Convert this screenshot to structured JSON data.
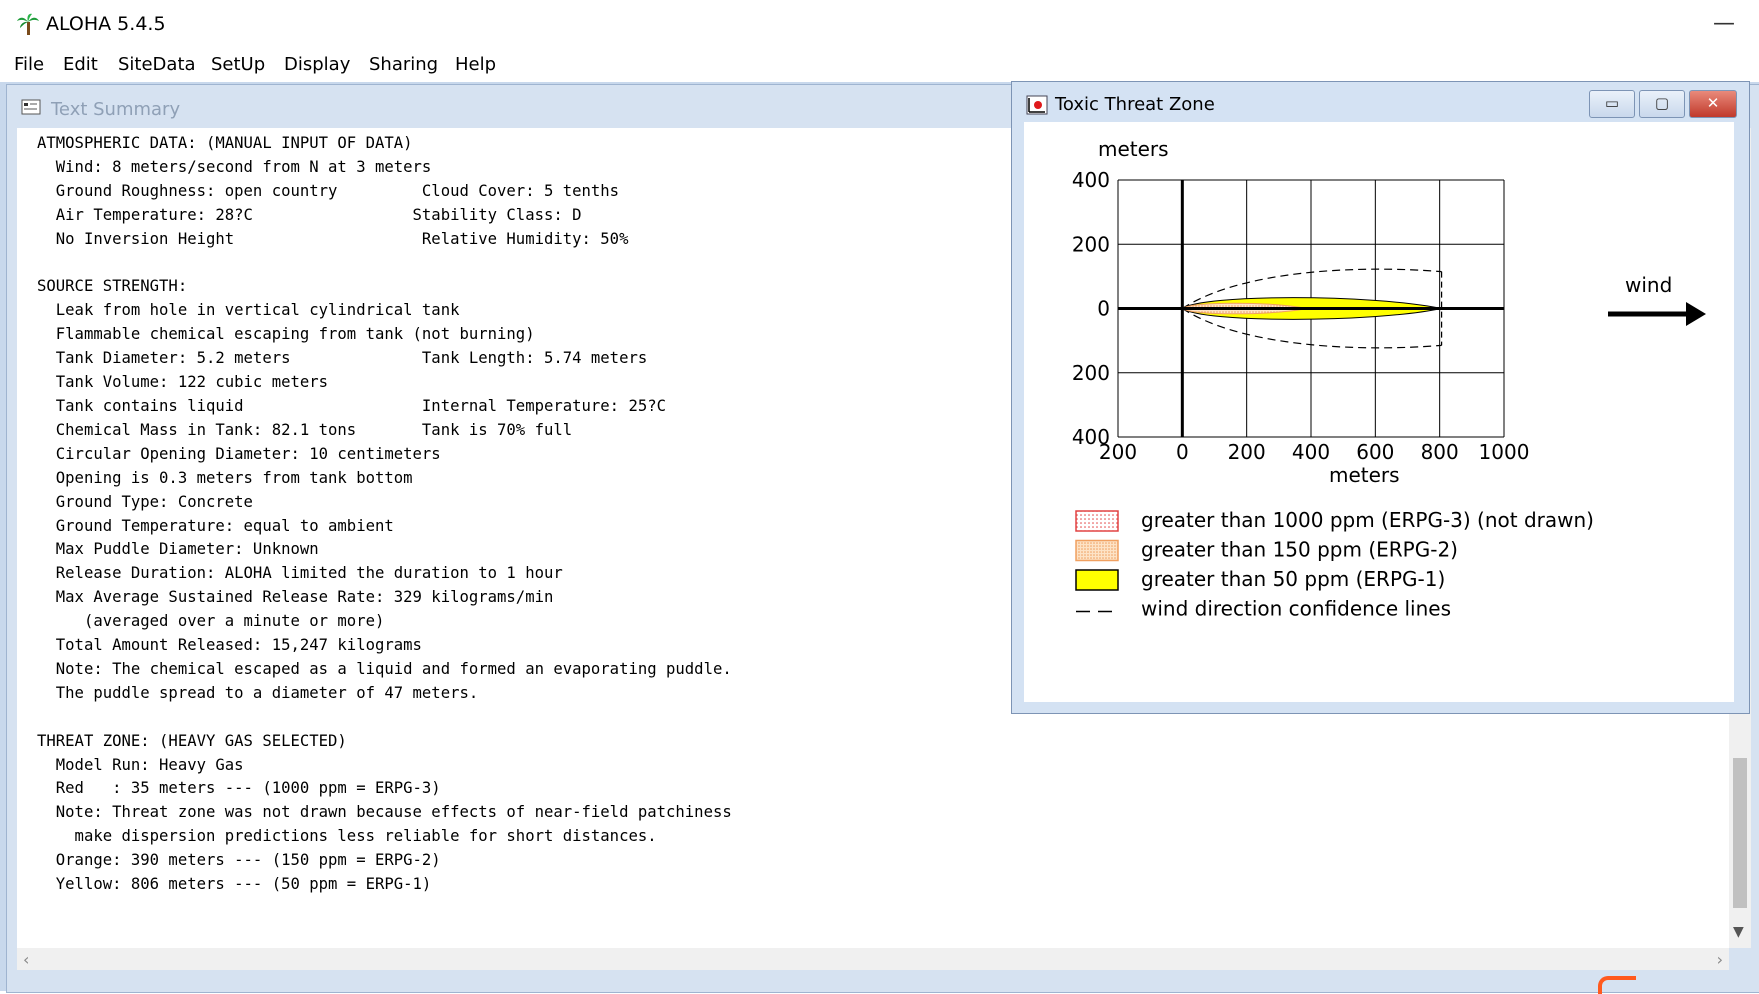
{
  "app": {
    "title": "ALOHA 5.4.5",
    "icon": "palm-tree-icon"
  },
  "titlebar": {
    "minimize_glyph": "—"
  },
  "menu": [
    "File",
    "Edit",
    "SiteData",
    "SetUp",
    "Display",
    "Sharing",
    "Help"
  ],
  "text_summary": {
    "title": "Text Summary",
    "lines": [
      "ATMOSPHERIC DATA: (MANUAL INPUT OF DATA)",
      "  Wind: 8 meters/second from N at 3 meters",
      "  Ground Roughness: open country         Cloud Cover: 5 tenths",
      "  Air Temperature: 28?C                 Stability Class: D",
      "  No Inversion Height                    Relative Humidity: 50%",
      "",
      "SOURCE STRENGTH:",
      "  Leak from hole in vertical cylindrical tank",
      "  Flammable chemical escaping from tank (not burning)",
      "  Tank Diameter: 5.2 meters              Tank Length: 5.74 meters",
      "  Tank Volume: 122 cubic meters",
      "  Tank contains liquid                   Internal Temperature: 25?C",
      "  Chemical Mass in Tank: 82.1 tons       Tank is 70% full",
      "  Circular Opening Diameter: 10 centimeters",
      "  Opening is 0.3 meters from tank bottom",
      "  Ground Type: Concrete",
      "  Ground Temperature: equal to ambient",
      "  Max Puddle Diameter: Unknown",
      "  Release Duration: ALOHA limited the duration to 1 hour",
      "  Max Average Sustained Release Rate: 329 kilograms/min",
      "     (averaged over a minute or more)",
      "  Total Amount Released: 15,247 kilograms",
      "  Note: The chemical escaped as a liquid and formed an evaporating puddle.",
      "  The puddle spread to a diameter of 47 meters.",
      "",
      "THREAT ZONE: (HEAVY GAS SELECTED)",
      "  Model Run: Heavy Gas",
      "  Red   : 35 meters --- (1000 ppm = ERPG-3)",
      "  Note: Threat zone was not drawn because effects of near-field patchiness",
      "    make dispersion predictions less reliable for short distances.",
      "  Orange: 390 meters --- (150 ppm = ERPG-2)",
      "  Yellow: 806 meters --- (50 ppm = ERPG-1)"
    ]
  },
  "threat_window": {
    "title": "Toxic Threat Zone",
    "buttons": {
      "minimize": "▭",
      "maximize": "▢",
      "close": "✕"
    },
    "y_axis_label": "meters",
    "x_axis_label": "meters",
    "y_ticks": [
      "400",
      "200",
      "0",
      "200",
      "400"
    ],
    "x_ticks": [
      "200",
      "0",
      "200",
      "400",
      "600",
      "800",
      "1000"
    ],
    "wind_label": "wind",
    "legend": [
      {
        "label": "greater than 1000 ppm (ERPG-3) (not drawn)",
        "color": "#e06060"
      },
      {
        "label": "greater than 150 ppm (ERPG-2)",
        "color": "#f2a06a"
      },
      {
        "label": "greater than 50 ppm (ERPG-1)",
        "color": "#ffff00"
      },
      {
        "label": "wind direction confidence lines",
        "color": "#000000"
      }
    ],
    "zones": {
      "red_m": 35,
      "orange_m": 390,
      "yellow_m": 806,
      "yellow_halfwidth_m": 45,
      "orange_halfwidth_m": 22,
      "confidence_halfwidth_m": 135
    }
  }
}
